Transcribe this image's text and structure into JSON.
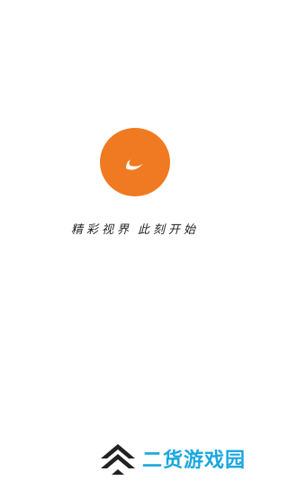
{
  "splash": {
    "tagline_part1": "精彩视界",
    "tagline_part2": "此刻开始",
    "logo_icon": "orange-circle-crescent-icon",
    "brand_color": "#f07a22"
  },
  "watermark": {
    "text": "二货游戏园",
    "icon": "chevron-stack-icon",
    "text_color": "#1aa7e0",
    "mark_color": "#222222"
  }
}
